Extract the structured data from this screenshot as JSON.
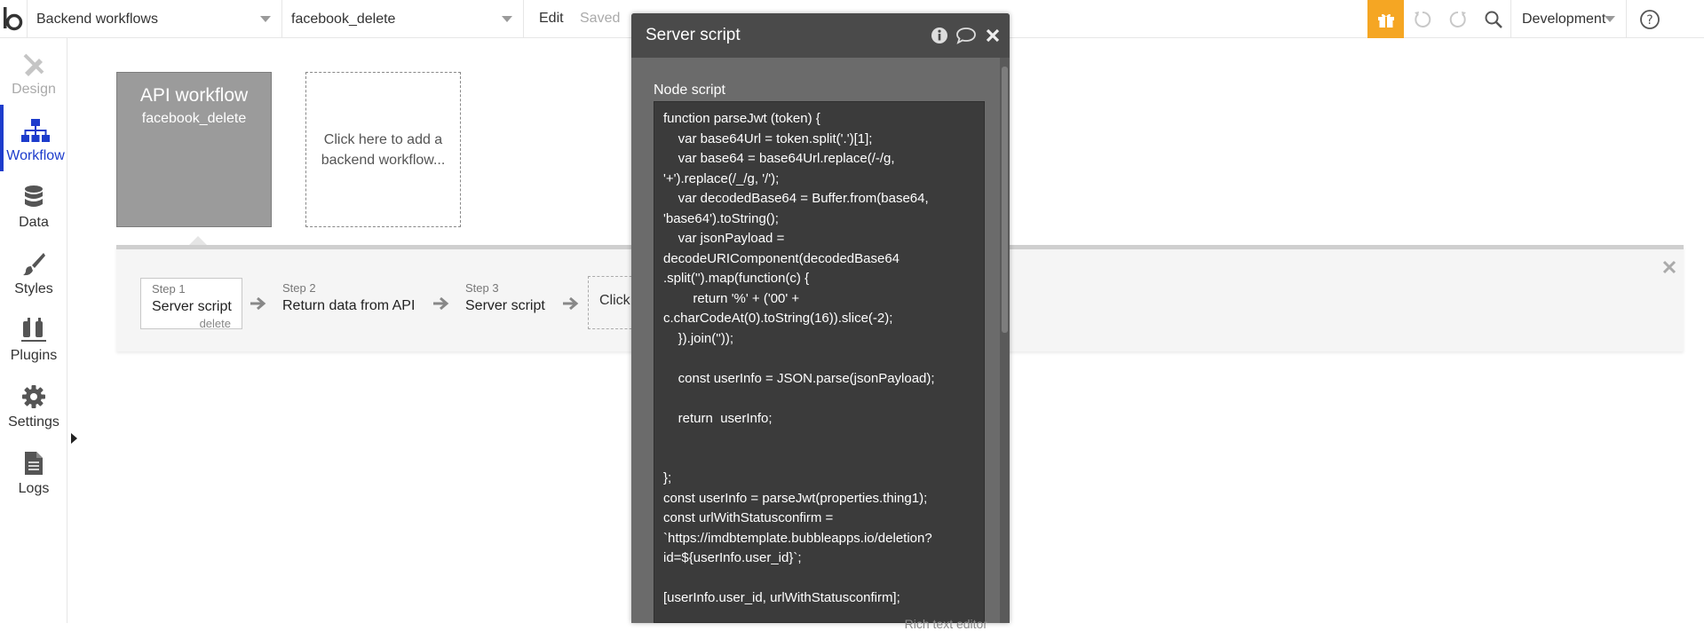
{
  "topbar": {
    "page_dropdown": "Backend workflows",
    "workflow_dropdown": "facebook_delete",
    "edit_label": "Edit",
    "saved_label": "Saved",
    "environment": "Development",
    "icons": [
      "gift-icon",
      "undo-icon",
      "redo-icon",
      "search-icon",
      "help-icon"
    ],
    "accent_color": "#f5a623"
  },
  "leftnav": {
    "items": [
      {
        "label": "Design",
        "icon": "design-icon"
      },
      {
        "label": "Workflow",
        "icon": "workflow-icon"
      },
      {
        "label": "Data",
        "icon": "database-icon"
      },
      {
        "label": "Styles",
        "icon": "brush-icon"
      },
      {
        "label": "Plugins",
        "icon": "plug-icon"
      },
      {
        "label": "Settings",
        "icon": "gear-icon"
      },
      {
        "label": "Logs",
        "icon": "document-icon"
      }
    ],
    "active_color": "#1d3ccc"
  },
  "canvas": {
    "api_box": {
      "title": "API workflow",
      "name": "facebook_delete"
    },
    "add_box": "Click here to add a backend workflow..."
  },
  "steps": {
    "items": [
      {
        "number": "Step 1",
        "label": "Server script",
        "sub": "delete"
      },
      {
        "number": "Step 2",
        "label": "Return data from API",
        "sub": ""
      },
      {
        "number": "Step 3",
        "label": "Server script",
        "sub": ""
      }
    ],
    "add_label": "Click"
  },
  "modal": {
    "title": "Server script",
    "node_label": "Node script",
    "code": "function parseJwt (token) {\n    var base64Url = token.split('.')[1];\n    var base64 = base64Url.replace(/-/g,\n'+').replace(/_/g, '/');\n    var decodedBase64 = Buffer.from(base64,\n'base64').toString();\n    var jsonPayload =\ndecodeURIComponent(decodedBase64\n.split('').map(function(c) {\n        return '%' + ('00' +\nc.charCodeAt(0).toString(16)).slice(-2);\n    }).join(''));\n\n    const userInfo = JSON.parse(jsonPayload);\n\n    return  userInfo;\n\n\n};\nconst userInfo = parseJwt(properties.thing1);\nconst urlWithStatusconfirm =\n`https://imdbtemplate.bubbleapps.io/deletion?\nid=${userInfo.user_id}`;\n\n[userInfo.user_id, urlWithStatusconfirm];",
    "rich_text_label": "Rich text editor"
  }
}
